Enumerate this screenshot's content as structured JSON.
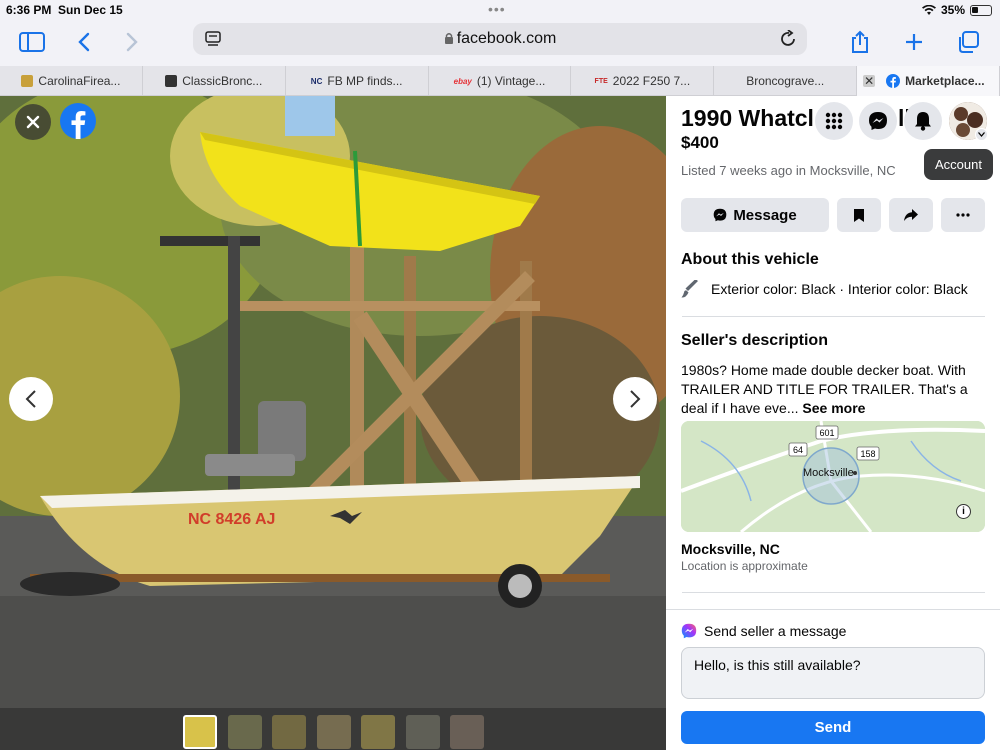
{
  "status": {
    "time": "6:36 PM",
    "date": "Sun Dec 15",
    "battery": "35%"
  },
  "browser": {
    "url": "facebook.com",
    "tabs": [
      {
        "label": "CarolinaFirea...",
        "icon_color": "#c8a03a"
      },
      {
        "label": "ClassicBronc...",
        "icon_color": "#333333"
      },
      {
        "label": "FB MP finds...",
        "icon_color": "#1c2d6b",
        "icon_text": "NC"
      },
      {
        "label": "(1) Vintage...",
        "icon_color": "#e53238",
        "icon_text": "ebay"
      },
      {
        "label": "2022 F250 7...",
        "icon_color": "#c62828",
        "icon_text": "FTE"
      },
      {
        "label": "Broncograve...",
        "icon_color": ""
      },
      {
        "label": "Marketplace...",
        "icon_color": "#1877f2",
        "active": true
      }
    ]
  },
  "listing": {
    "title": "1990 Whatcl",
    "title_suffix": "ll",
    "price": "$400",
    "listed": "Listed 7 weeks ago in Mocksville, NC",
    "message_label": "Message",
    "account_tooltip": "Account",
    "about_heading": "About this vehicle",
    "exterior": "Exterior color: Black · Interior color: Black",
    "desc_heading": "Seller's description",
    "description": "1980s? Home made double decker boat. With TRAILER AND TITLE FOR TRAILER. That's a deal if I have eve...",
    "see_more": "See more",
    "map": {
      "city_label": "Mocksville",
      "routes": [
        "601",
        "64",
        "158"
      ]
    },
    "location_city": "Mocksville, NC",
    "location_note": "Location is approximate",
    "send_message_heading": "Send seller a message",
    "message_text": "Hello, is this still available?",
    "send_label": "Send"
  },
  "photo": {
    "plate": "NC 8426 AJ",
    "thumbnail_count": 7
  },
  "colors": {
    "fb_blue": "#1877f2",
    "boat_yellow": "#f2e21a",
    "hull": "#d9c672"
  }
}
